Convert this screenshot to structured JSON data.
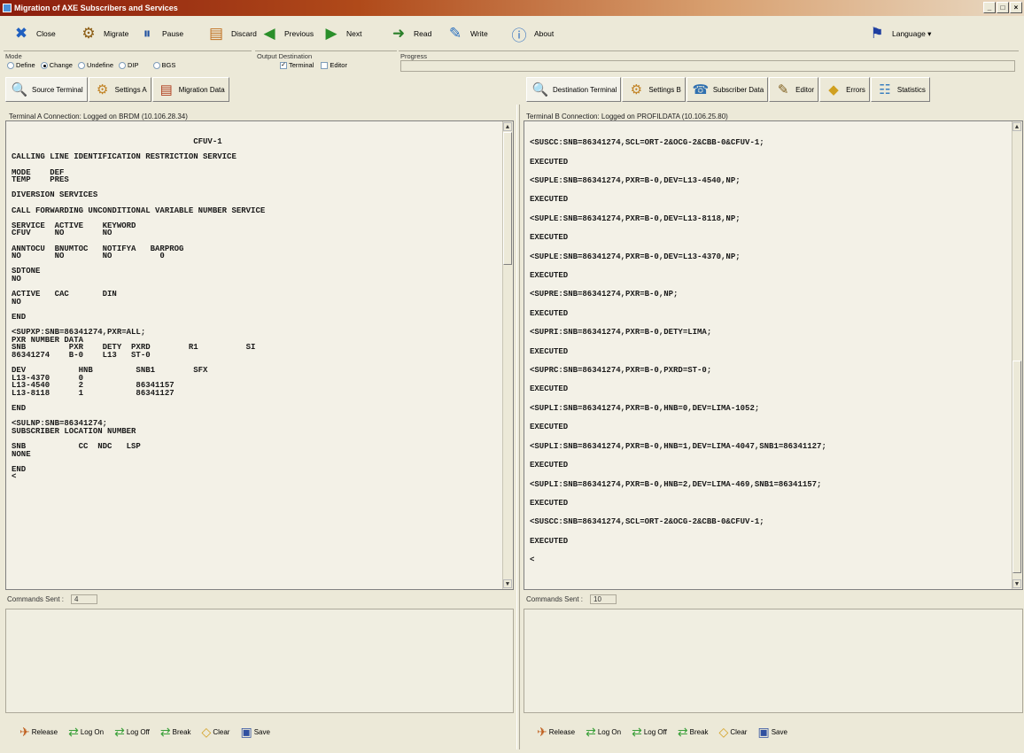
{
  "window": {
    "title": "Migration of AXE Subscribers and Services",
    "controls": [
      "_",
      "□",
      "×"
    ]
  },
  "toolbar": {
    "close": {
      "label": "Close",
      "icon": "close-icon"
    },
    "migrate": {
      "label": "Migrate",
      "icon": "migrate-icon"
    },
    "pause": {
      "label": "Pause",
      "icon": "pause-icon"
    },
    "discard": {
      "label": "Discard",
      "icon": "discard-icon"
    },
    "previous": {
      "label": "Previous",
      "icon": "previous-icon"
    },
    "next": {
      "label": "Next",
      "icon": "next-icon"
    },
    "read": {
      "label": "Read",
      "icon": "read-icon"
    },
    "write": {
      "label": "Write",
      "icon": "write-icon"
    },
    "about": {
      "label": "About",
      "icon": "about-icon"
    },
    "language": {
      "label": "Language ▾",
      "icon": "language-icon"
    }
  },
  "mode": {
    "label": "Mode",
    "options": [
      {
        "label": "Define",
        "selected": false
      },
      {
        "label": "Change",
        "selected": true
      },
      {
        "label": "Undefine",
        "selected": false
      },
      {
        "label": "DIP",
        "selected": false
      },
      {
        "label": "BGS",
        "selected": false
      }
    ]
  },
  "output_destination": {
    "label": "Output Destination",
    "terminal": {
      "label": "Terminal",
      "checked": true
    },
    "editor": {
      "label": "Editor",
      "checked": false
    }
  },
  "progress": {
    "label": "Progress",
    "value": 0
  },
  "left": {
    "tabs": [
      {
        "label": "Source Terminal",
        "icon": "source-terminal-icon",
        "active": true
      },
      {
        "label": "Settings A",
        "icon": "settings-icon",
        "active": false
      },
      {
        "label": "Migration Data",
        "icon": "migration-data-icon",
        "active": false
      }
    ],
    "connection": "Terminal A Connection: Logged on BRDM (10.106.28.34)",
    "terminal_text": "                                      CFUV-1\n\nCALLING LINE IDENTIFICATION RESTRICTION SERVICE\n\nMODE    DEF\nTEMP    PRES\n\nDIVERSION SERVICES\n\nCALL FORWARDING UNCONDITIONAL VARIABLE NUMBER SERVICE\n\nSERVICE  ACTIVE    KEYWORD\nCFUV     NO        NO\n\nANNTOCU  BNUMTOC   NOTIFYA   BARPROG\nNO       NO        NO          0\n\nSDTONE\nNO\n\nACTIVE   CAC       DIN\nNO\n\nEND\n\n<SUPXP:SNB=86341274,PXR=ALL;\nPXR NUMBER DATA\nSNB         PXR    DETY  PXRD        R1          SI\n86341274    B-0    L13   ST-0\n\nDEV           HNB         SNB1        SFX\nL13-4370      0\nL13-4540      2           86341157\nL13-8118      1           86341127\n\nEND\n\n<SULNP:SNB=86341274;\nSUBSCRIBER LOCATION NUMBER\n\nSNB           CC  NDC   LSP\nNONE\n\nEND\n<",
    "commands_sent_label": "Commands Sent :",
    "commands_sent": "4"
  },
  "right": {
    "tabs": [
      {
        "label": "Destination Terminal",
        "icon": "destination-terminal-icon",
        "active": true
      },
      {
        "label": "Settings B",
        "icon": "settings-icon",
        "active": false
      },
      {
        "label": "Subscriber Data",
        "icon": "subscriber-data-icon",
        "active": false
      },
      {
        "label": "Editor",
        "icon": "editor-icon",
        "active": false
      },
      {
        "label": "Errors",
        "icon": "errors-icon",
        "active": false
      },
      {
        "label": "Statistics",
        "icon": "statistics-icon",
        "active": false
      }
    ],
    "connection": "Terminal B Connection: Logged on PROFILDATA (10.106.25.80)",
    "terminal_text": "<SUSCC:SNB=86341274,SCL=ORT-2&OCG-2&CBB-0&CFUV-1;\n\nEXECUTED\n\n<SUPLE:SNB=86341274,PXR=B-0,DEV=L13-4540,NP;\n\nEXECUTED\n\n<SUPLE:SNB=86341274,PXR=B-0,DEV=L13-8118,NP;\n\nEXECUTED\n\n<SUPLE:SNB=86341274,PXR=B-0,DEV=L13-4370,NP;\n\nEXECUTED\n\n<SUPRE:SNB=86341274,PXR=B-0,NP;\n\nEXECUTED\n\n<SUPRI:SNB=86341274,PXR=B-0,DETY=LIMA;\n\nEXECUTED\n\n<SUPRC:SNB=86341274,PXR=B-0,PXRD=ST-0;\n\nEXECUTED\n\n<SUPLI:SNB=86341274,PXR=B-0,HNB=0,DEV=LIMA-1052;\n\nEXECUTED\n\n<SUPLI:SNB=86341274,PXR=B-0,HNB=1,DEV=LIMA-4047,SNB1=86341127;\n\nEXECUTED\n\n<SUPLI:SNB=86341274,PXR=B-0,HNB=2,DEV=LIMA-469,SNB1=86341157;\n\nEXECUTED\n\n<SUSCC:SNB=86341274,SCL=ORT-2&OCG-2&CBB-0&CFUV-1;\n\nEXECUTED\n\n<",
    "commands_sent_label": "Commands Sent :",
    "commands_sent": "10"
  },
  "bottom_buttons": [
    {
      "label": "Release",
      "icon": "release-icon"
    },
    {
      "label": "Log On",
      "icon": "log-on-icon"
    },
    {
      "label": "Log Off",
      "icon": "log-off-icon"
    },
    {
      "label": "Break",
      "icon": "break-icon"
    },
    {
      "label": "Clear",
      "icon": "clear-icon"
    },
    {
      "label": "Save",
      "icon": "save-icon"
    }
  ]
}
